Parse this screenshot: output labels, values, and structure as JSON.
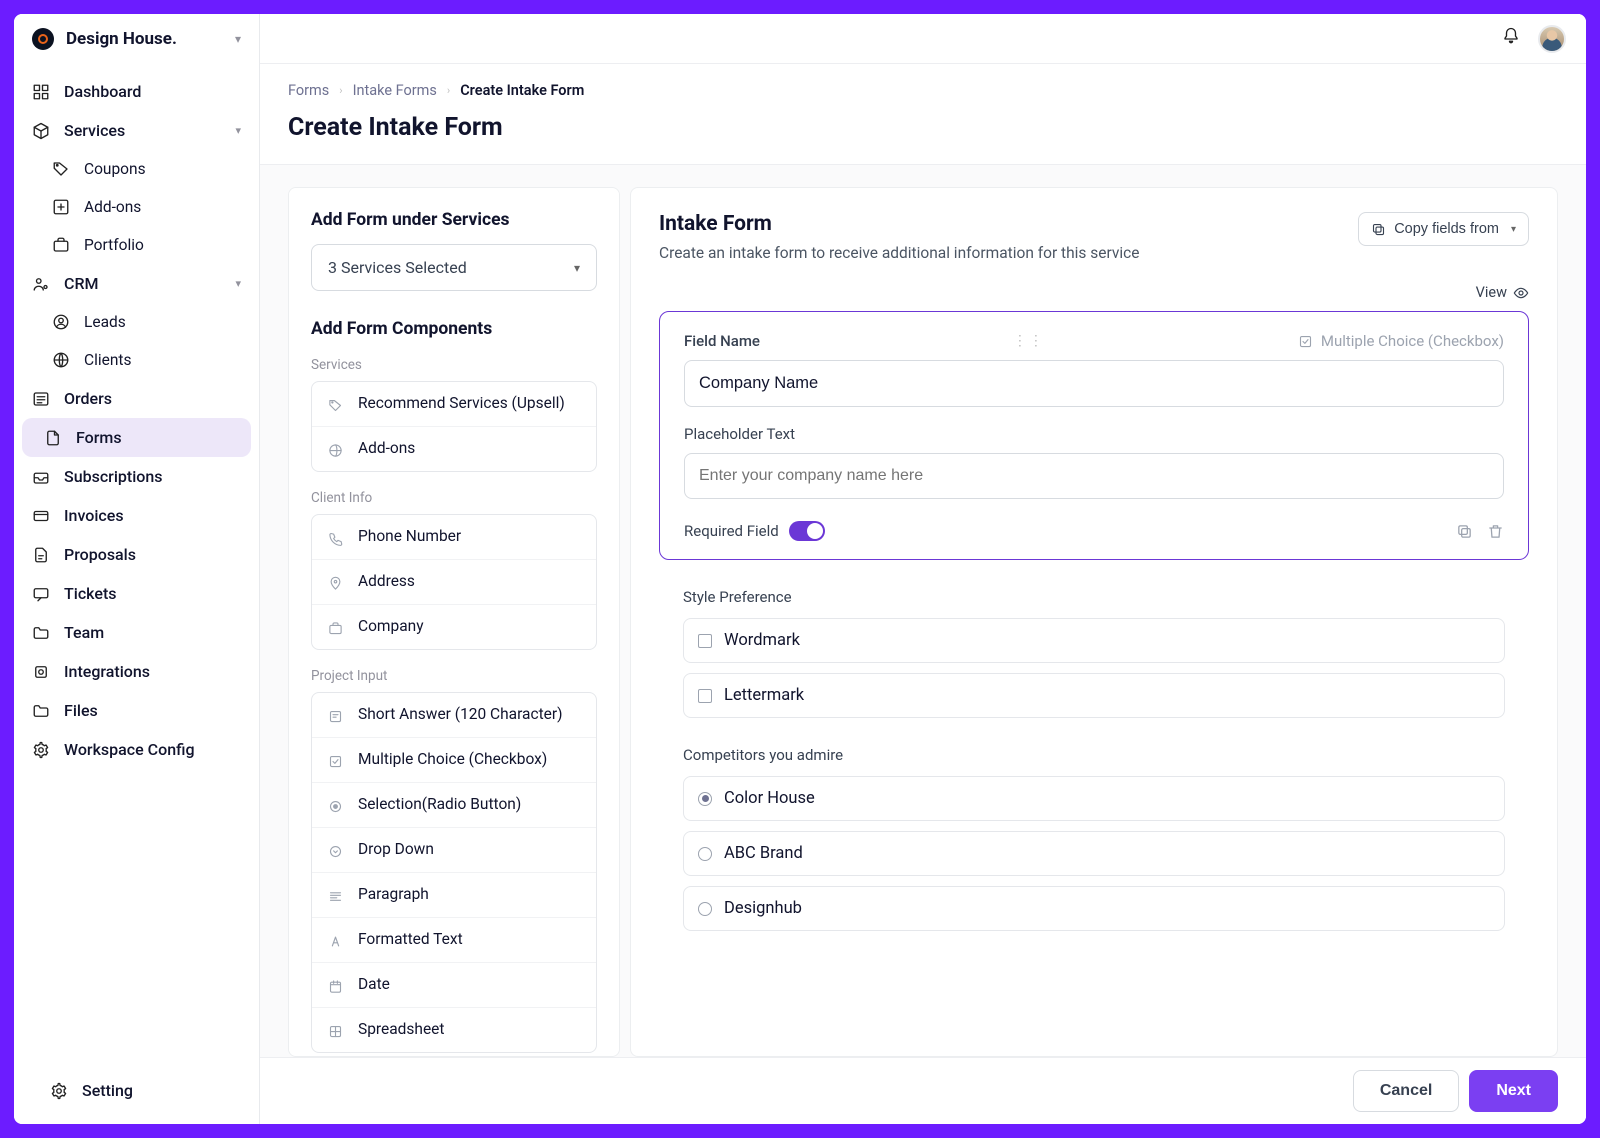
{
  "brand": {
    "name": "Design House."
  },
  "sidebar": {
    "dashboard": "Dashboard",
    "services": "Services",
    "coupons": "Coupons",
    "addons": "Add-ons",
    "portfolio": "Portfolio",
    "crm": "CRM",
    "leads": "Leads",
    "clients": "Clients",
    "orders": "Orders",
    "forms": "Forms",
    "subscriptions": "Subscriptions",
    "invoices": "Invoices",
    "proposals": "Proposals",
    "tickets": "Tickets",
    "team": "Team",
    "integrations": "Integrations",
    "files": "Files",
    "workspace": "Workspace Config",
    "setting": "Setting"
  },
  "breadcrumb": {
    "a": "Forms",
    "b": "Intake Forms",
    "c": "Create Intake Form"
  },
  "page_title": "Create Intake Form",
  "left": {
    "add_under": "Add Form under Services",
    "services_selected": "3 Services Selected",
    "add_components": "Add Form Components",
    "groups": {
      "services": "Services",
      "client_info": "Client Info",
      "project_input": "Project Input"
    },
    "components": {
      "recommend": "Recommend Services (Upsell)",
      "addons": "Add-ons",
      "phone": "Phone Number",
      "address": "Address",
      "company": "Company",
      "short_answer": "Short Answer (120 Character)",
      "multiple_choice": "Multiple Choice (Checkbox)",
      "selection": "Selection(Radio Button)",
      "dropdown": "Drop Down",
      "paragraph": "Paragraph",
      "formatted": "Formatted Text",
      "date": "Date",
      "spreadsheet": "Spreadsheet"
    }
  },
  "right": {
    "title": "Intake Form",
    "subtitle": "Create an intake form to receive additional information for this service",
    "copy_label": "Copy fields from",
    "view": "View",
    "field": {
      "label_fieldname": "Field Name",
      "type": "Multiple Choice (Checkbox)",
      "value": "Company Name",
      "label_placeholder": "Placeholder Text",
      "placeholder": "Enter your company name here",
      "required_label": "Required Field"
    },
    "q1": {
      "label": "Style Preference",
      "opt1": "Wordmark",
      "opt2": "Lettermark"
    },
    "q2": {
      "label": "Competitors you admire",
      "opt1": "Color House",
      "opt2": "ABC Brand",
      "opt3": "Designhub"
    }
  },
  "footer": {
    "cancel": "Cancel",
    "next": "Next"
  }
}
